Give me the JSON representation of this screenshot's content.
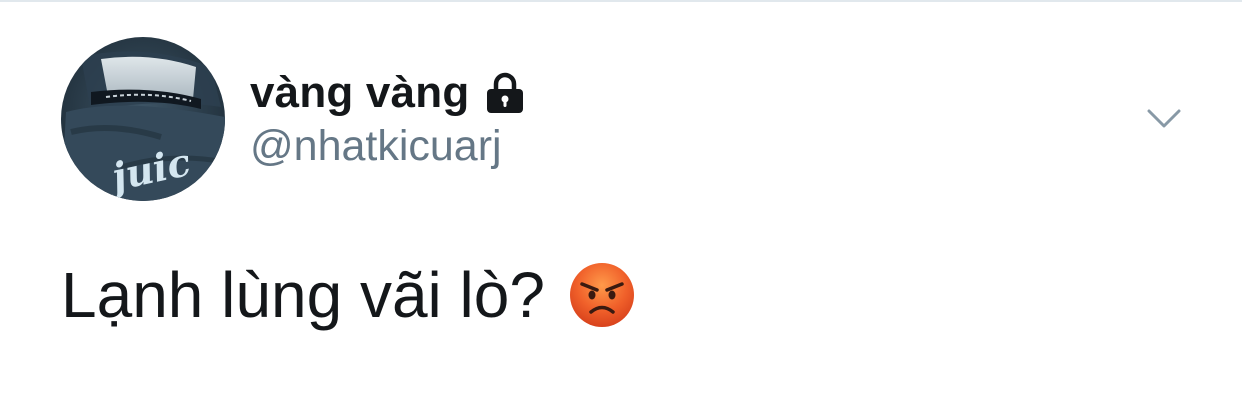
{
  "tweet": {
    "display_name": "vàng vàng",
    "handle": "@nhatkicuarj",
    "text": "Lạnh lùng vãi lò?",
    "protected_icon": "lock-icon",
    "emoji": "angry-face-icon",
    "menu_icon": "chevron-down-icon",
    "avatar_overlay_text": "juic"
  },
  "colors": {
    "name": "#14171a",
    "handle": "#657786",
    "divider": "#e1e8ed",
    "chevron": "#8899a6"
  }
}
